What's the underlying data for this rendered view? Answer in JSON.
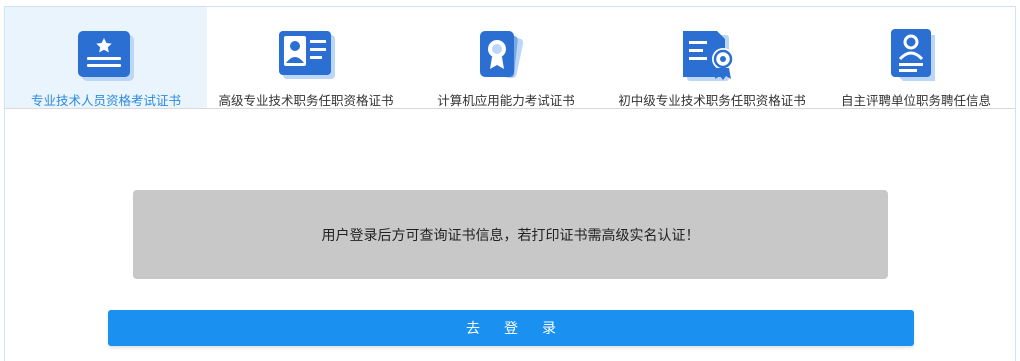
{
  "tabs": [
    {
      "label": "专业技术人员资格考试证书",
      "icon": "certificate-star-icon",
      "active": true
    },
    {
      "label": "高级专业技术职务任职资格证书",
      "icon": "id-card-icon",
      "active": false
    },
    {
      "label": "计算机应用能力考试证书",
      "icon": "award-cards-icon",
      "active": false
    },
    {
      "label": "初中级专业技术职务任职资格证书",
      "icon": "document-seal-icon",
      "active": false
    },
    {
      "label": "自主评聘单位职务聘任信息",
      "icon": "user-document-icon",
      "active": false
    }
  ],
  "notice": {
    "text": "用户登录后方可查询证书信息，若打印证书需高级实名认证！"
  },
  "login_button": {
    "label": "去登录"
  },
  "colors": {
    "icon_blue": "#2a6fd1",
    "icon_light": "#bcd6f5",
    "active_tab_bg": "#eaf4fd",
    "active_label": "#2d8ae0",
    "button": "#1a90f0",
    "notice_bg": "#c8c8c8"
  }
}
